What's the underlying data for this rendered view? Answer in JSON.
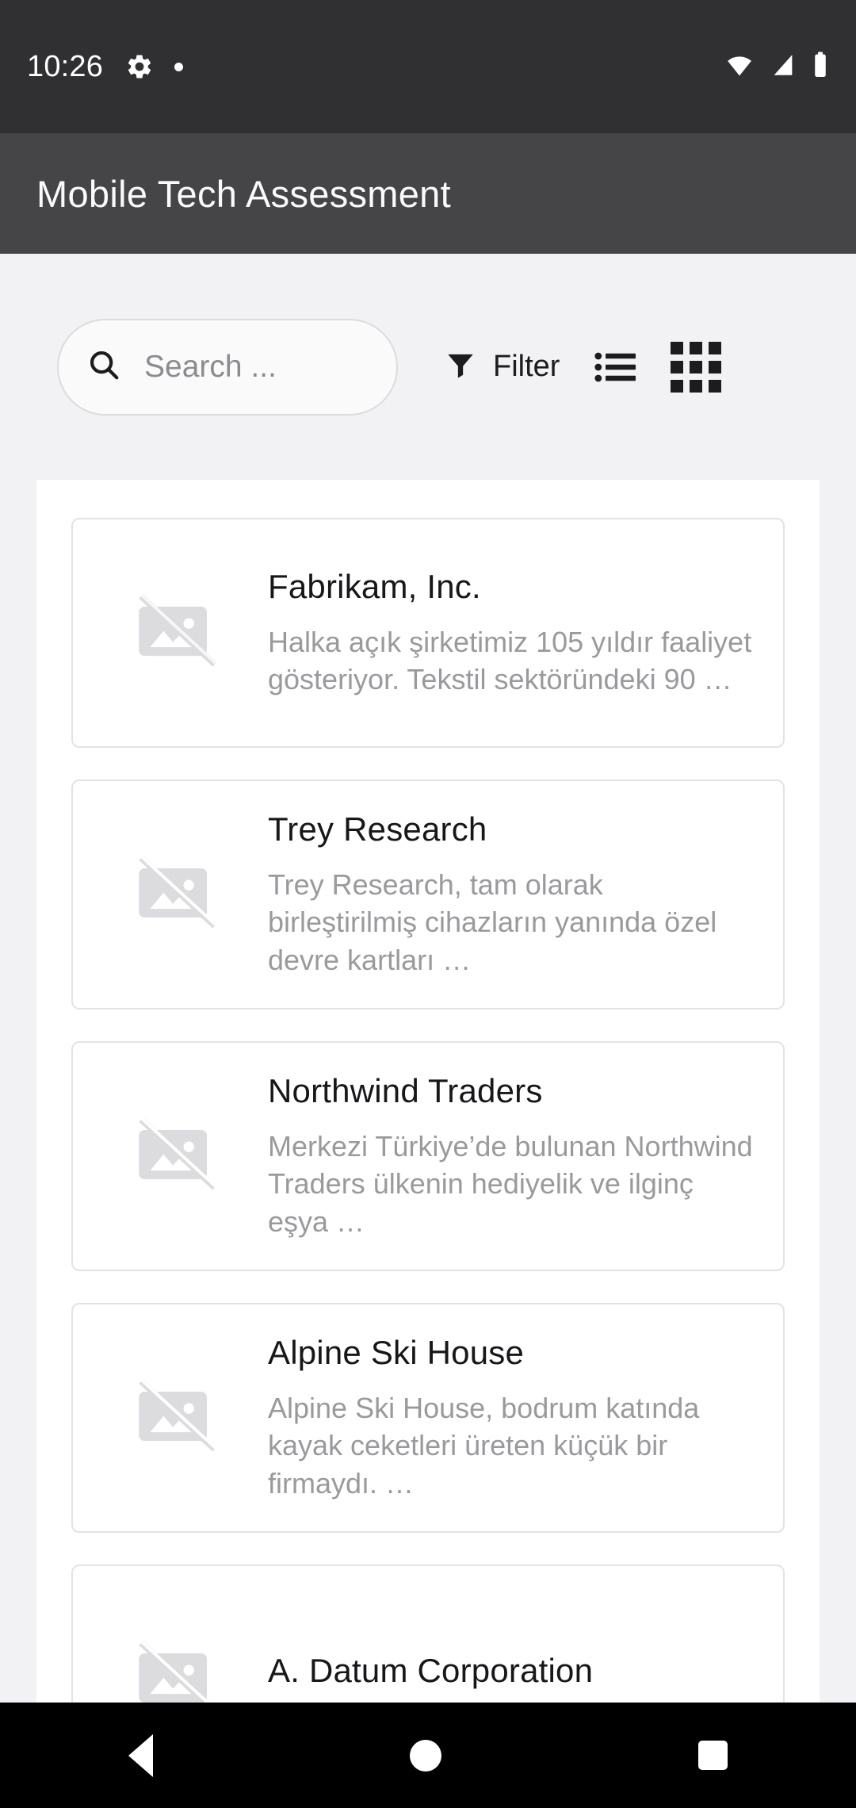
{
  "status_bar": {
    "time": "10:26",
    "left_icons": [
      "gear-icon",
      "dot-indicator"
    ],
    "right_icons": [
      "wifi-icon",
      "cellular-signal-icon",
      "battery-icon"
    ],
    "background": "#303032"
  },
  "app_bar": {
    "title": "Mobile Tech Assessment",
    "background": "#454547",
    "text_color": "#fafafa"
  },
  "toolbar": {
    "search": {
      "value": "",
      "placeholder": "Search ...",
      "icon": "search-icon"
    },
    "filter": {
      "label": "Filter",
      "icon": "filter-funnel-icon"
    },
    "list_view": {
      "icon": "list-view-icon"
    },
    "grid_view": {
      "icon": "grid-view-icon"
    }
  },
  "list": {
    "items": [
      {
        "title": "Fabrikam, Inc.",
        "description": "Halka açık şirketimiz 105 yıldır faaliyet gösteriyor. Tekstil sektöründeki 90 …",
        "thumb_icon": "broken-image-icon"
      },
      {
        "title": "Trey Research",
        "description": "Trey Research, tam olarak birleştirilmiş cihazların yanında özel devre kartları …",
        "thumb_icon": "broken-image-icon"
      },
      {
        "title": "Northwind Traders",
        "description": "Merkezi Türkiye’de bulunan Northwind Traders ülkenin hediyelik ve ilginç eşya …",
        "thumb_icon": "broken-image-icon"
      },
      {
        "title": "Alpine Ski House",
        "description": "Alpine Ski House, bodrum katında kayak ceketleri üreten küçük bir firmaydı. …",
        "thumb_icon": "broken-image-icon"
      },
      {
        "title": "A. Datum Corporation",
        "description": "",
        "thumb_icon": "broken-image-icon"
      }
    ]
  },
  "nav_bar": {
    "back": "back-button",
    "home": "home-button",
    "recents": "recents-button",
    "background": "#000000"
  }
}
